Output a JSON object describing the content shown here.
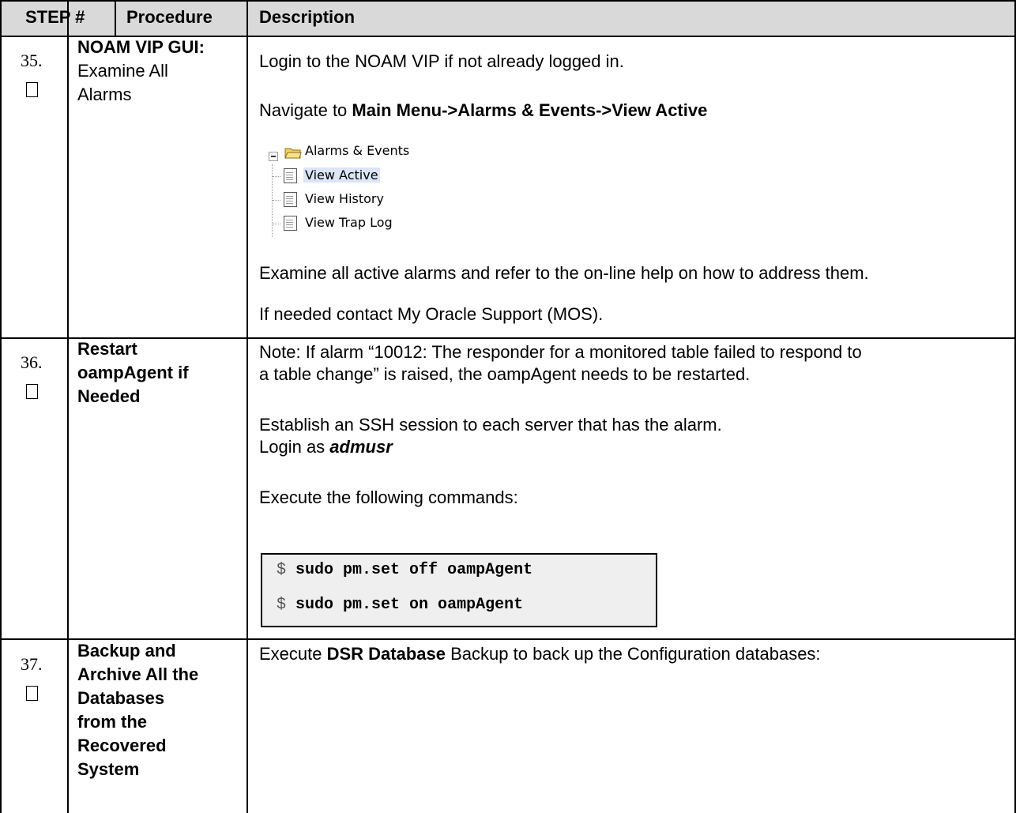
{
  "header": {
    "step": "STEP #",
    "procedure": "Procedure",
    "description": "Description"
  },
  "steps": [
    {
      "number": "35.",
      "procedure_bold": "NOAM VIP GUI:",
      "procedure_rest_1": "Examine All",
      "procedure_rest_2": "Alarms",
      "desc_line1": "Login to the NOAM VIP if not already logged in.",
      "desc_nav_prefix": "Navigate to ",
      "desc_nav_bold": "Main Menu->Alarms & Events->View Active",
      "tree": {
        "folder": "Alarms & Events",
        "items": [
          "View Active",
          "View History",
          "View Trap Log"
        ]
      },
      "desc_line3": "Examine all active alarms and refer to the on-line help on how to address them.",
      "desc_line4": "If needed contact My Oracle Support (MOS)."
    },
    {
      "number": "36.",
      "procedure_lines": [
        "Restart",
        "oampAgent if",
        "Needed"
      ],
      "desc_note_1": "Note: If alarm “10012: The responder for a monitored table failed to respond to",
      "desc_note_2": "a table change” is raised, the oampAgent needs to be restarted.",
      "desc_ssh": "Establish an SSH session to each server that has the alarm.",
      "desc_login_prefix": "Login as ",
      "desc_login_user": "admusr",
      "desc_exec": "Execute the following commands:",
      "commands": [
        {
          "prompt": "$",
          "cmd": "sudo pm.set off oampAgent"
        },
        {
          "prompt": "$",
          "cmd": "sudo pm.set on oampAgent"
        }
      ]
    },
    {
      "number": "37.",
      "procedure_lines": [
        "Backup and",
        "Archive All the",
        "Databases",
        "from the",
        "Recovered",
        "System"
      ],
      "desc_prefix": "Execute ",
      "desc_bold": "DSR Database",
      "desc_suffix": " Backup to back up the Configuration databases:"
    }
  ]
}
